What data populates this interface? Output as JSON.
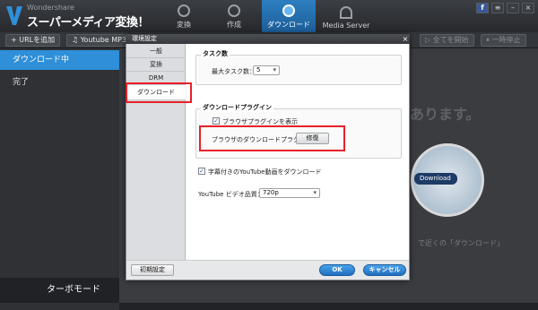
{
  "app": {
    "brand_small": "Wondershare",
    "brand_big": "スーパーメディア変換！"
  },
  "nav_tabs": [
    {
      "label": "変換",
      "icon": "convert-icon"
    },
    {
      "label": "作成",
      "icon": "disc-icon"
    },
    {
      "label": "ダウンロード",
      "icon": "download-icon"
    },
    {
      "label": "Media Server",
      "icon": "wifi-icon"
    }
  ],
  "window_controls": {
    "facebook": "f",
    "menu": "≡",
    "minimize": "–",
    "close": "×"
  },
  "toolbar": {
    "add_url": "+ URLを追加",
    "youtube_mp3": "♫ Youtube MP3",
    "start_all": "▷ 全てを開始",
    "pause_all": "⏸ 一時停止"
  },
  "sidebar": {
    "downloading": "ダウンロード中",
    "completed": "完了",
    "turbo": "ターボモード"
  },
  "background": {
    "message": "あります。",
    "hint": "で近くの「ダウンロード」",
    "download_pill": "Download"
  },
  "dialog": {
    "title": "環境設定",
    "close": "×",
    "nav": [
      "一般",
      "変換",
      "DRM",
      "ダウンロード"
    ],
    "task_group": {
      "title": "タスク数",
      "max_tasks_label": "最大タスク数：",
      "max_tasks_value": "5"
    },
    "plugin_group": {
      "title": "ダウンロードプラグイン",
      "show_plugin": "ブラウザプラグインを表示",
      "show_plugin_checked": true,
      "browser_plugin_label": "ブラウザのダウンロードプラグイン:",
      "repair_button": "修復"
    },
    "subtitle_option": "字幕付きのYouTube動画をダウンロード",
    "subtitle_checked": true,
    "quality_label": "YouTube ビデオ品質：",
    "quality_value": "720p",
    "reset_button": "初期設定",
    "ok_button": "OK",
    "cancel_button": "キャンセル"
  },
  "colors": {
    "accent": "#2f8fd8",
    "highlight": "#e8202a",
    "titlebar": "#36383c"
  }
}
